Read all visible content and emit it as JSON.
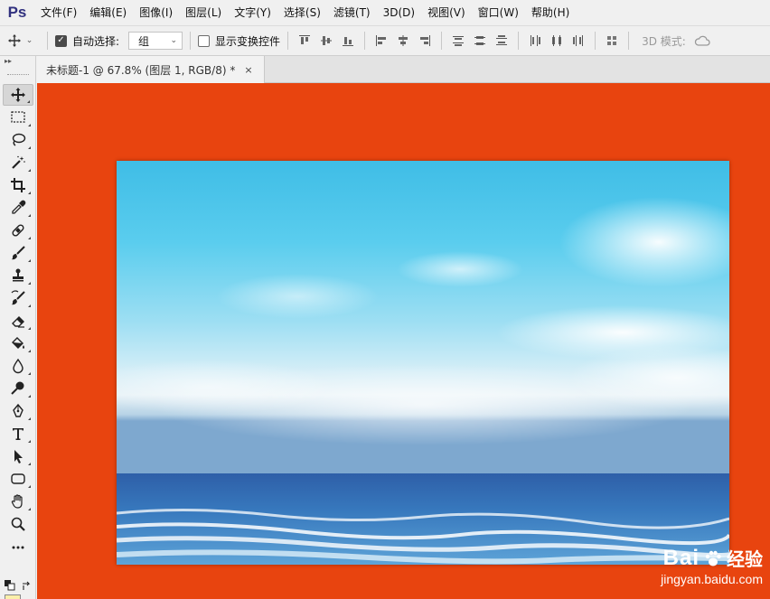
{
  "app": {
    "logo": "Ps"
  },
  "menu": [
    "文件(F)",
    "编辑(E)",
    "图像(I)",
    "图层(L)",
    "文字(Y)",
    "选择(S)",
    "滤镜(T)",
    "3D(D)",
    "视图(V)",
    "窗口(W)",
    "帮助(H)"
  ],
  "options": {
    "auto_select_label": "自动选择:",
    "auto_select_checked": true,
    "auto_select_value": "组",
    "show_transform_label": "显示变换控件",
    "show_transform_checked": false,
    "mode_3d_label": "3D 模式:"
  },
  "toolbox": {
    "header": "▸▸",
    "tools": [
      "move-tool",
      "marquee-tool",
      "lasso-tool",
      "magic-wand-tool",
      "crop-tool",
      "eyedropper-tool",
      "healing-brush-tool",
      "brush-tool",
      "clone-stamp-tool",
      "history-brush-tool",
      "eraser-tool",
      "paint-bucket-tool",
      "blur-tool",
      "dodge-tool",
      "pen-tool",
      "type-tool",
      "path-selection-tool",
      "rectangle-tool",
      "hand-tool",
      "zoom-tool",
      "more-tools"
    ],
    "active_tool": "move-tool",
    "foreground_color": "#fbefaa"
  },
  "document": {
    "tab_title": "未标题-1 @ 67.8% (图层 1, RGB/8) *",
    "close_glyph": "×",
    "canvas_color": "#e8440f"
  },
  "watermark": {
    "logo_text": "Bai",
    "logo_suffix": "经验",
    "url": "jingyan.baidu.com"
  }
}
